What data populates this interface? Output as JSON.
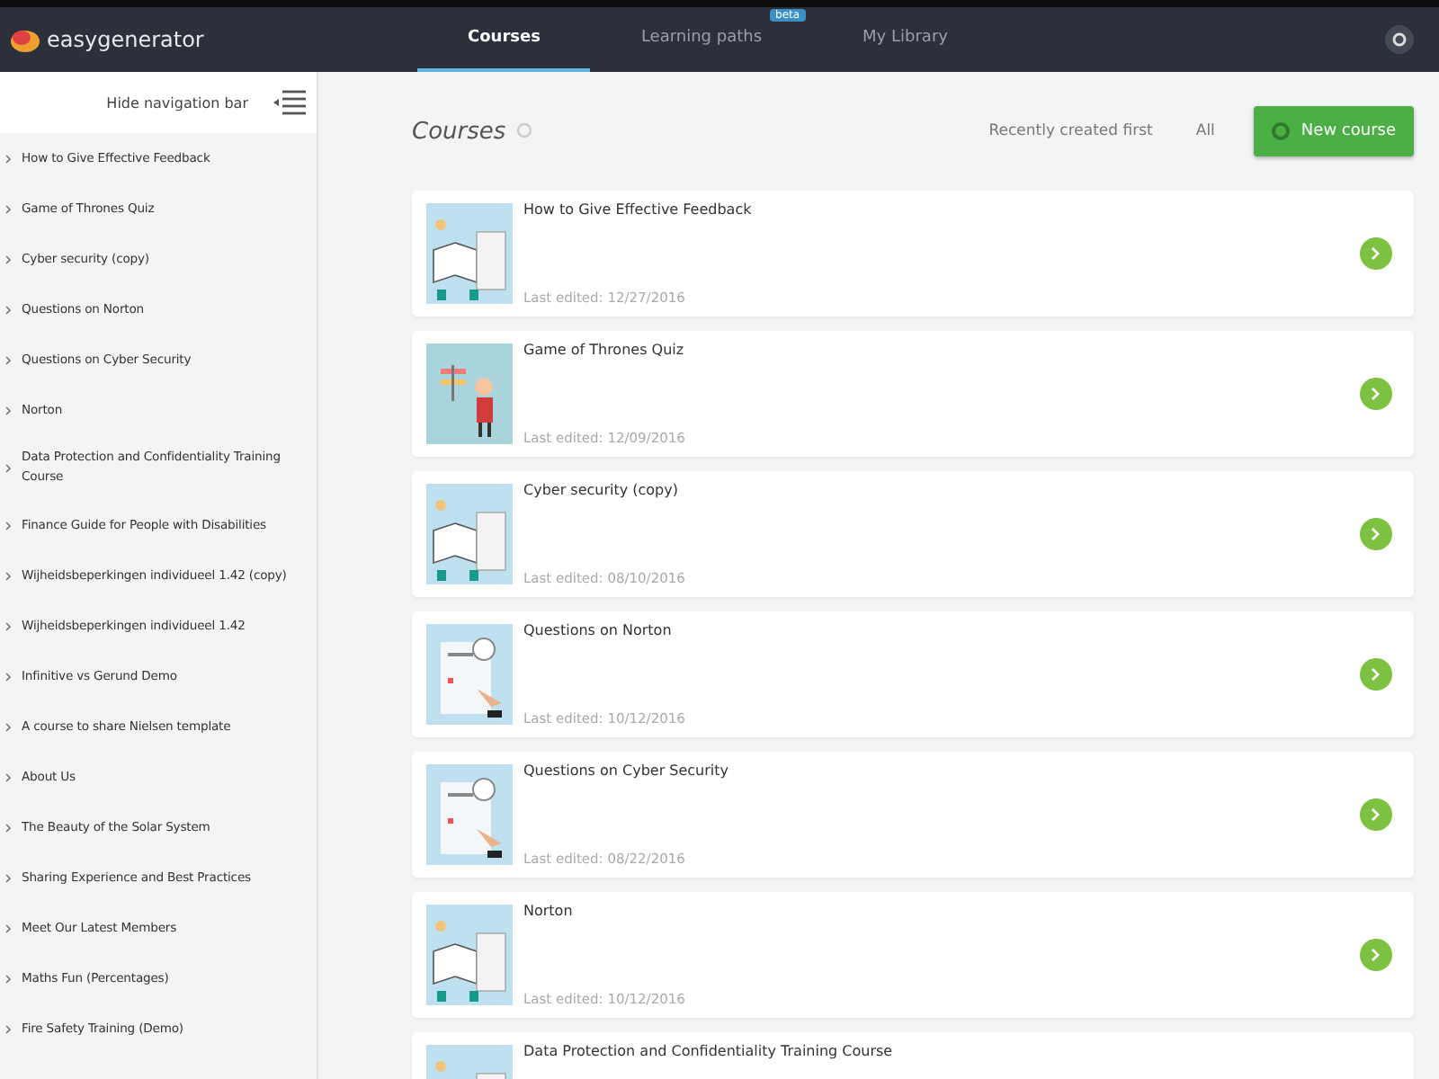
{
  "header": {
    "brand": "easygenerator",
    "tabs": [
      {
        "label": "Courses",
        "selected": true
      },
      {
        "label": "Learning paths",
        "selected": false,
        "badge": "beta"
      },
      {
        "label": "My Library",
        "selected": false
      }
    ]
  },
  "sidebar": {
    "toggle": "Hide navigation bar",
    "items": [
      "How to Give Effective Feedback",
      "Game of Thrones Quiz",
      "Cyber security (copy)",
      "Questions on Norton",
      "Questions on Cyber Security",
      "Norton",
      "Data Protection and Confidentiality Training Course",
      "Finance Guide for People with Disabilities",
      "Wijheidsbeperkingen individueel 1.42 (copy)",
      "Wijheidsbeperkingen individueel 1.42",
      "Infinitive vs Gerund Demo",
      "A course to share Nielsen template",
      "About Us",
      "The Beauty of the Solar System",
      "Sharing Experience and Best Practices",
      "Meet Our Latest Members",
      "Maths Fun (Percentages)",
      "Fire Safety Training (Demo)"
    ]
  },
  "main": {
    "title": "Courses",
    "sort": "Recently created first",
    "filter": "All",
    "new_button": "New course",
    "courses": [
      {
        "title": "How to Give Effective Feedback",
        "edited": "Last edited: 12/27/2016",
        "kind": "books"
      },
      {
        "title": "Game of Thrones Quiz",
        "edited": "Last edited: 12/09/2016",
        "kind": "person"
      },
      {
        "title": "Cyber security (copy)",
        "edited": "Last edited: 08/10/2016",
        "kind": "books"
      },
      {
        "title": "Questions on Norton",
        "edited": "Last edited: 10/12/2016",
        "kind": "clipboard"
      },
      {
        "title": "Questions on Cyber Security",
        "edited": "Last edited: 08/22/2016",
        "kind": "clipboard"
      },
      {
        "title": "Norton",
        "edited": "Last edited: 10/12/2016",
        "kind": "books"
      },
      {
        "title": "Data Protection and Confidentiality Training Course",
        "kind": "books"
      }
    ]
  }
}
